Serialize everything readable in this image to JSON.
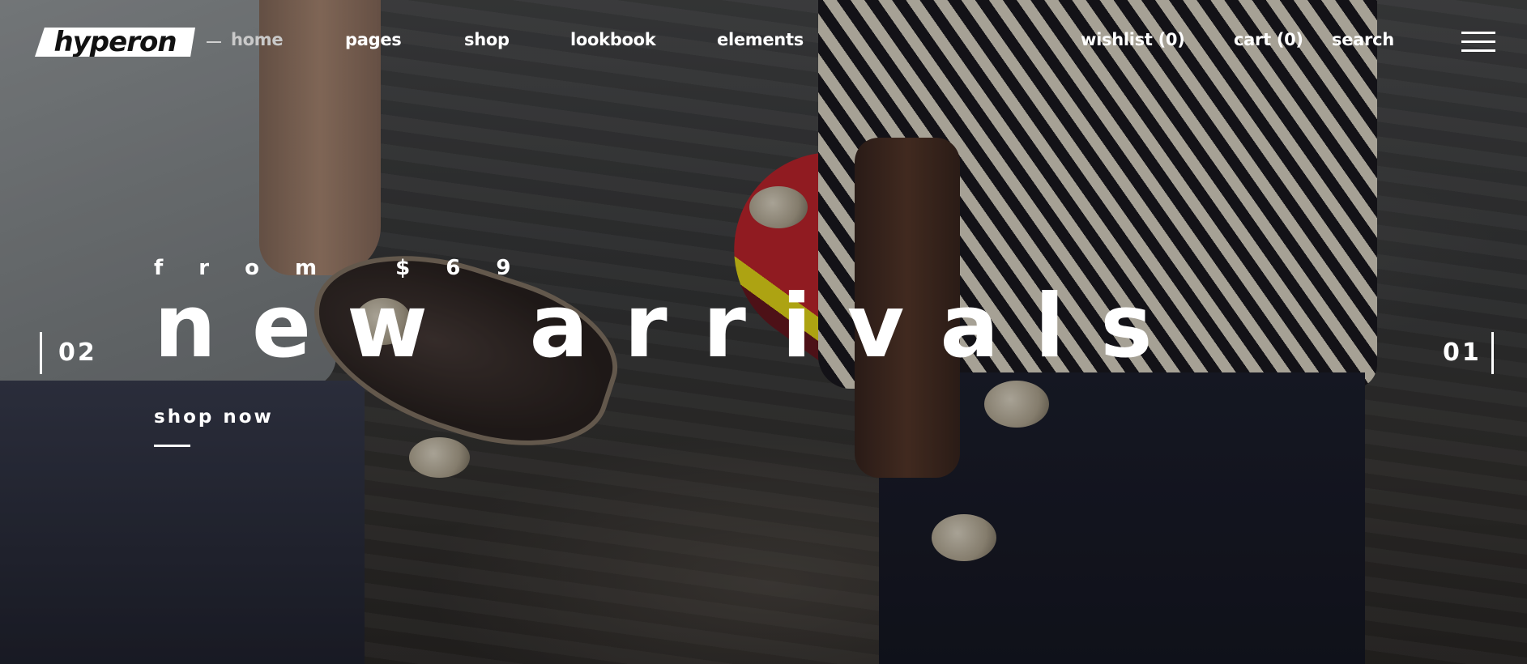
{
  "header": {
    "logo_text": "hyperon",
    "nav": [
      {
        "label": "home",
        "active": true
      },
      {
        "label": "pages"
      },
      {
        "label": "shop"
      },
      {
        "label": "lookbook"
      },
      {
        "label": "elements"
      }
    ],
    "wishlist": "wishlist (0)",
    "cart": "cart (0)",
    "search": "search",
    "menu_icon": "hamburger-menu-icon"
  },
  "hero": {
    "eyebrow": "from $69",
    "headline": "new arrivals",
    "cta": "shop now",
    "prev_slide": "02",
    "next_slide": "01"
  },
  "colors": {
    "text": "#ffffff",
    "active_nav": "#c9c9c9",
    "overlay": "rgba(0,0,0,0.28)"
  }
}
